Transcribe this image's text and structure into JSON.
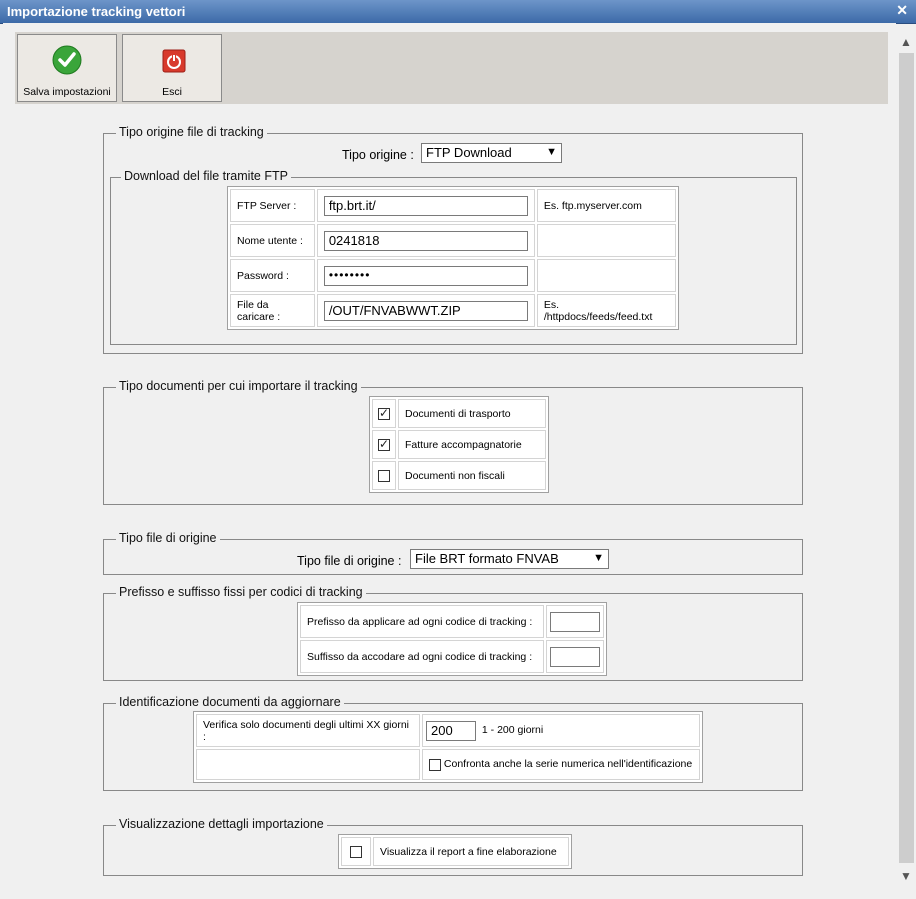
{
  "window": {
    "title": "Importazione tracking vettori"
  },
  "toolbar": {
    "save_label": "Salva impostazioni",
    "exit_label": "Esci"
  },
  "origin": {
    "legend": "Tipo origine file di tracking",
    "type_label": "Tipo origine :",
    "type_value": "FTP Download",
    "ftp": {
      "legend": "Download del file tramite FTP",
      "server_label": "FTP Server :",
      "server_value": "ftp.brt.it/",
      "server_hint": "Es. ftp.myserver.com",
      "user_label": "Nome utente :",
      "user_value": "0241818",
      "password_label": "Password :",
      "password_value": "••••••••",
      "file_label": "File da caricare :",
      "file_value": "/OUT/FNVABWWT.ZIP",
      "file_hint": "Es. /httpdocs/feeds/feed.txt"
    }
  },
  "doctypes": {
    "legend": "Tipo documenti per cui importare il tracking",
    "items": [
      {
        "label": "Documenti di trasporto",
        "checked": true
      },
      {
        "label": "Fatture accompagnatorie",
        "checked": true
      },
      {
        "label": "Documenti non fiscali",
        "checked": false
      }
    ]
  },
  "filetype": {
    "legend": "Tipo file di origine",
    "label": "Tipo file di origine :",
    "value": "File BRT formato FNVAB"
  },
  "prefix": {
    "legend": "Prefisso e suffisso fissi per codici di tracking",
    "prefix_label": "Prefisso da applicare ad ogni codice di tracking :",
    "prefix_value": "",
    "suffix_label": "Suffisso da accodare ad ogni codice di tracking :",
    "suffix_value": ""
  },
  "identify": {
    "legend": "Identificazione documenti da aggiornare",
    "days_label": "Verifica solo documenti degli ultimi XX giorni :",
    "days_value": "200",
    "days_hint": "1 - 200 giorni",
    "series_label": "Confronta anche la serie numerica nell'identificazione",
    "series_checked": false
  },
  "details": {
    "legend": "Visualizzazione dettagli importazione",
    "report_label": "Visualizza il report a fine elaborazione",
    "report_checked": false
  }
}
